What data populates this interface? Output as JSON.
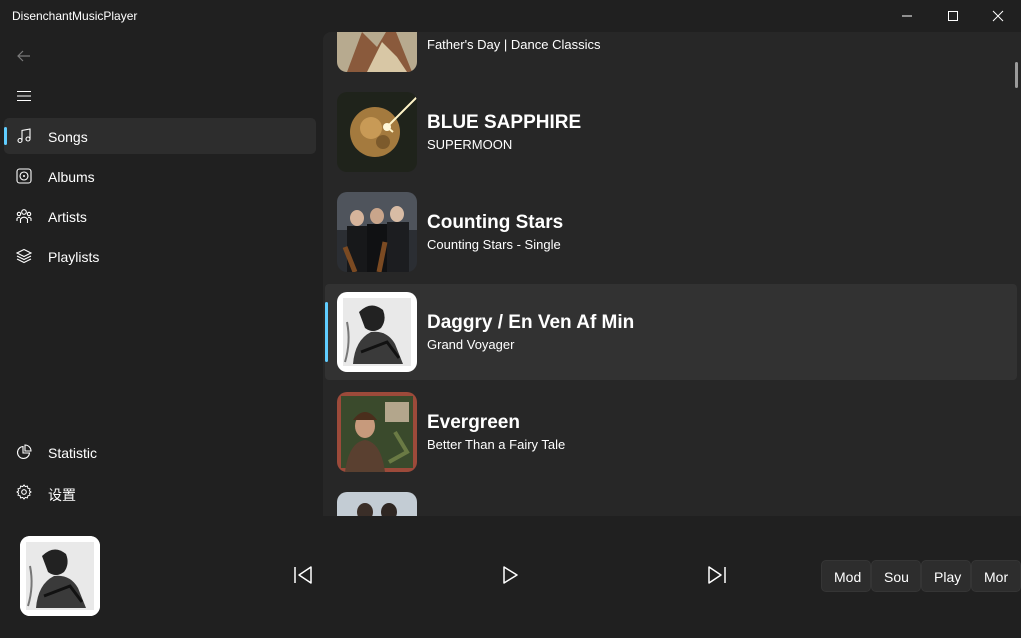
{
  "window": {
    "title": "DisenchantMusicPlayer"
  },
  "nav": {
    "items": [
      {
        "label": "Songs",
        "icon": "music-note-icon",
        "selected": true
      },
      {
        "label": "Albums",
        "icon": "album-icon",
        "selected": false
      },
      {
        "label": "Artists",
        "icon": "artists-icon",
        "selected": false
      },
      {
        "label": "Playlists",
        "icon": "layers-icon",
        "selected": false
      }
    ],
    "footer_items": [
      {
        "label": "Statistic",
        "icon": "pie-chart-icon"
      },
      {
        "label": "设置",
        "icon": "gear-icon"
      }
    ]
  },
  "songs": [
    {
      "title": "",
      "album": "Father's Day | Dance Classics",
      "selected": false
    },
    {
      "title": "BLUE SAPPHIRE",
      "album": "SUPERMOON",
      "selected": false
    },
    {
      "title": "Counting Stars",
      "album": "Counting Stars - Single",
      "selected": false
    },
    {
      "title": "Daggry / En Ven Af Min",
      "album": "Grand Voyager",
      "selected": true
    },
    {
      "title": "Evergreen",
      "album": "Better Than a Fairy Tale",
      "selected": false
    },
    {
      "title": "",
      "album": "",
      "selected": false
    }
  ],
  "player": {
    "buttons": [
      "previous-track",
      "play",
      "next-track"
    ],
    "chips": [
      "Mod",
      "Sou",
      "Play",
      "Mor"
    ]
  },
  "colors": {
    "accent": "#60cdff",
    "background": "#202020",
    "content_background": "#272727",
    "selected_row": "#323232"
  }
}
